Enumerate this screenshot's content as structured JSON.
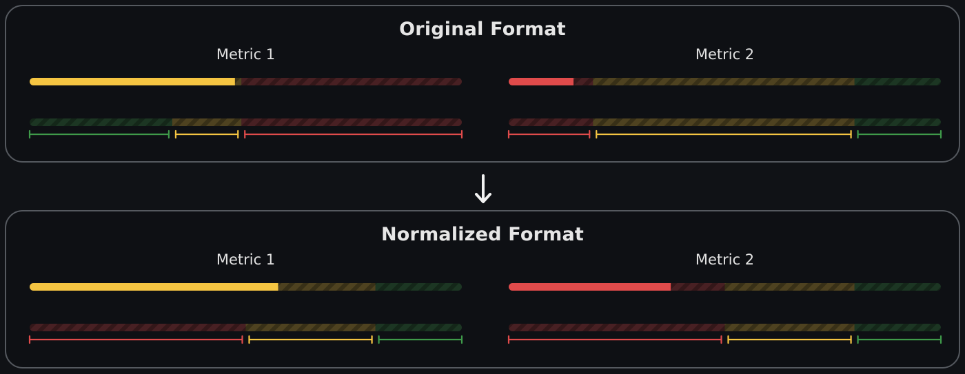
{
  "panels": [
    {
      "id": "original",
      "title": "Original Format",
      "metrics": [
        {
          "label": "Metric 1",
          "value": 0.475,
          "fill_color": "#f5c542",
          "ranges": [
            {
              "from": 0.0,
              "to": 0.33,
              "color": "#3f9a4a"
            },
            {
              "from": 0.33,
              "to": 0.49,
              "color": "#f5c542"
            },
            {
              "from": 0.49,
              "to": 1.0,
              "color": "#e04b4b"
            }
          ]
        },
        {
          "label": "Metric 2",
          "value": 0.15,
          "fill_color": "#e04b4b",
          "ranges": [
            {
              "from": 0.0,
              "to": 0.195,
              "color": "#e04b4b"
            },
            {
              "from": 0.195,
              "to": 0.8,
              "color": "#f5c542"
            },
            {
              "from": 0.8,
              "to": 1.0,
              "color": "#3f9a4a"
            }
          ]
        }
      ]
    },
    {
      "id": "normalized",
      "title": "Normalized Format",
      "metrics": [
        {
          "label": "Metric 1",
          "value": 0.575,
          "fill_color": "#f5c542",
          "ranges": [
            {
              "from": 0.0,
              "to": 0.5,
              "color": "#e04b4b"
            },
            {
              "from": 0.5,
              "to": 0.8,
              "color": "#f5c542"
            },
            {
              "from": 0.8,
              "to": 1.0,
              "color": "#3f9a4a"
            }
          ]
        },
        {
          "label": "Metric 2",
          "value": 0.375,
          "fill_color": "#e04b4b",
          "ranges": [
            {
              "from": 0.0,
              "to": 0.5,
              "color": "#e04b4b"
            },
            {
              "from": 0.5,
              "to": 0.8,
              "color": "#f5c542"
            },
            {
              "from": 0.8,
              "to": 1.0,
              "color": "#3f9a4a"
            }
          ]
        }
      ]
    }
  ],
  "colors": {
    "background": "#101216",
    "panel_border": "#55595f",
    "track": "#3a4147",
    "green": "#3f9a4a",
    "yellow": "#f5c542",
    "red": "#e04b4b"
  },
  "arrow_icon": "arrow-down-icon"
}
